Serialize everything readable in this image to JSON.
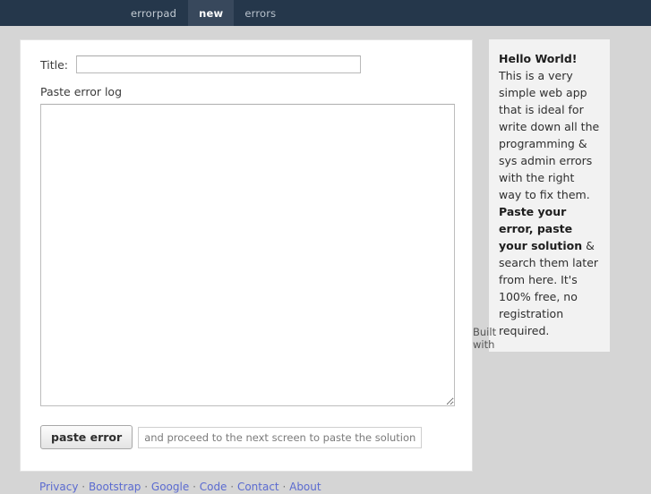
{
  "navbar": {
    "brand": "errorpad",
    "items": [
      {
        "label": "new",
        "active": true
      },
      {
        "label": "errors",
        "active": false
      }
    ]
  },
  "form": {
    "title_label": "Title:",
    "title_value": "",
    "title_placeholder": "",
    "error_log_label": "Paste error log",
    "error_log_value": "",
    "error_log_placeholder": "",
    "submit_label": "paste error",
    "submit_hint": "and proceed to the next screen to paste the solution"
  },
  "sidebar": {
    "heading": "Hello World!",
    "body_part1": " This is a very simple web app that is ideal for write down all the programming & sys admin errors with the right way to fix them. ",
    "emphasis": "Paste your error, paste your solution",
    "body_part2": " & search them later from here. It's 100% free, no registration required."
  },
  "built_with": "Built with",
  "footer": {
    "links": [
      "Privacy",
      "Bootstrap",
      "Google",
      "Code",
      "Contact",
      "About"
    ],
    "separator": "·"
  },
  "colors": {
    "navbar_bg": "#25374b",
    "navbar_active_bg": "#38485c",
    "page_bg": "#d5d5d5",
    "card_bg": "#ffffff",
    "sidebar_bg": "#f2f2f2",
    "link": "#5b6bd0"
  }
}
